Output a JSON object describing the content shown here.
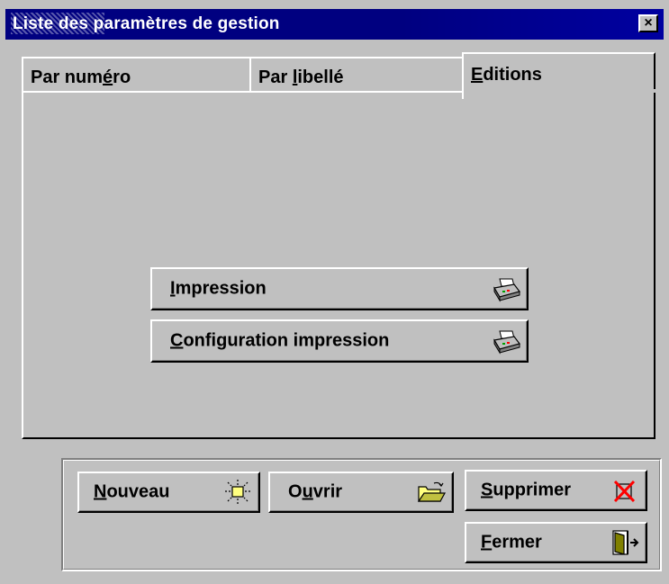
{
  "window": {
    "title": "Liste des paramètres de gestion",
    "close_glyph": "×"
  },
  "tabs": [
    {
      "pre": "Par num",
      "accel": "é",
      "post": "ro",
      "active": false
    },
    {
      "pre": "Par ",
      "accel": "l",
      "post": "ibellé",
      "active": false
    },
    {
      "pre": "",
      "accel": "E",
      "post": "ditions",
      "active": true
    }
  ],
  "panel_buttons": [
    {
      "pre": "",
      "accel": "I",
      "post": "mpression",
      "icon": "printer-icon"
    },
    {
      "pre": "",
      "accel": "C",
      "post": "onfiguration impression",
      "icon": "printer-icon"
    }
  ],
  "footer_buttons": {
    "nouveau": {
      "pre": "",
      "accel": "N",
      "post": "ouveau",
      "icon": "new-document-icon"
    },
    "ouvrir": {
      "pre": "O",
      "accel": "u",
      "post": "vrir",
      "icon": "open-folder-icon"
    },
    "supprimer": {
      "pre": "",
      "accel": "S",
      "post": "upprimer",
      "icon": "delete-icon"
    },
    "fermer": {
      "pre": "",
      "accel": "F",
      "post": "ermer",
      "icon": "exit-door-icon"
    }
  },
  "colors": {
    "title_bar": "#000080",
    "face": "#c0c0c0",
    "delete_x": "#ff0000",
    "door": "#808000",
    "new_icon": "#ffff80"
  }
}
